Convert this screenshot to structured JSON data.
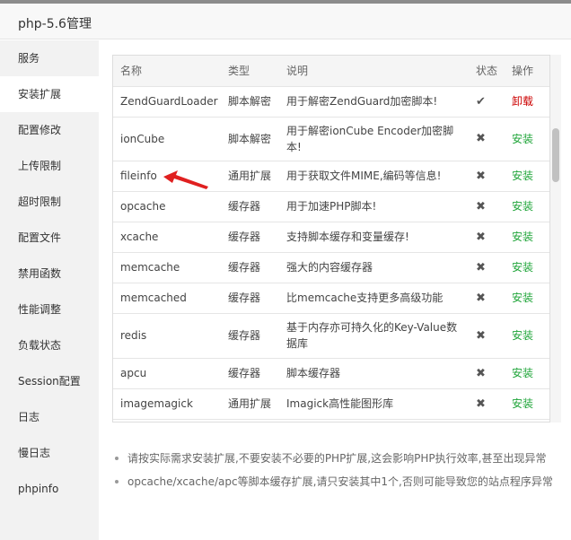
{
  "window": {
    "title": "php-5.6管理"
  },
  "sidebar": {
    "items": [
      {
        "label": "服务"
      },
      {
        "label": "安装扩展",
        "active": true
      },
      {
        "label": "配置修改"
      },
      {
        "label": "上传限制"
      },
      {
        "label": "超时限制"
      },
      {
        "label": "配置文件"
      },
      {
        "label": "禁用函数"
      },
      {
        "label": "性能调整"
      },
      {
        "label": "负载状态"
      },
      {
        "label": "Session配置"
      },
      {
        "label": "日志"
      },
      {
        "label": "慢日志"
      },
      {
        "label": "phpinfo"
      }
    ]
  },
  "table": {
    "headers": {
      "name": "名称",
      "type": "类型",
      "desc": "说明",
      "status": "状态",
      "action": "操作"
    },
    "rows": [
      {
        "name": "ZendGuardLoader",
        "type": "脚本解密",
        "desc": "用于解密ZendGuard加密脚本!",
        "status": "✔",
        "action": "卸载",
        "action_color": "#cc0000"
      },
      {
        "name": "ionCube",
        "type": "脚本解密",
        "desc": "用于解密ionCube Encoder加密脚本!",
        "status": "✖",
        "action": "安装",
        "action_color": "#20a53a"
      },
      {
        "name": "fileinfo",
        "type": "通用扩展",
        "desc": "用于获取文件MIME,编码等信息!",
        "status": "✖",
        "action": "安装",
        "action_color": "#20a53a"
      },
      {
        "name": "opcache",
        "type": "缓存器",
        "desc": "用于加速PHP脚本!",
        "status": "✖",
        "action": "安装",
        "action_color": "#20a53a"
      },
      {
        "name": "xcache",
        "type": "缓存器",
        "desc": "支持脚本缓存和变量缓存!",
        "status": "✖",
        "action": "安装",
        "action_color": "#20a53a"
      },
      {
        "name": "memcache",
        "type": "缓存器",
        "desc": "强大的内容缓存器",
        "status": "✖",
        "action": "安装",
        "action_color": "#20a53a"
      },
      {
        "name": "memcached",
        "type": "缓存器",
        "desc": "比memcache支持更多高级功能",
        "status": "✖",
        "action": "安装",
        "action_color": "#20a53a"
      },
      {
        "name": "redis",
        "type": "缓存器",
        "desc": "基于内存亦可持久化的Key-Value数据库",
        "status": "✖",
        "action": "安装",
        "action_color": "#20a53a"
      },
      {
        "name": "apcu",
        "type": "缓存器",
        "desc": "脚本缓存器",
        "status": "✖",
        "action": "安装",
        "action_color": "#20a53a"
      },
      {
        "name": "imagemagick",
        "type": "通用扩展",
        "desc": "Imagick高性能图形库",
        "status": "✖",
        "action": "安装",
        "action_color": "#20a53a"
      }
    ]
  },
  "notes": [
    "请按实际需求安装扩展,不要安装不必要的PHP扩展,这会影响PHP执行效率,甚至出现异常",
    "opcache/xcache/apc等脚本缓存扩展,请只安装其中1个,否则可能导致您的站点程序异常"
  ],
  "annotation": {
    "arrow_color": "#e02020"
  }
}
